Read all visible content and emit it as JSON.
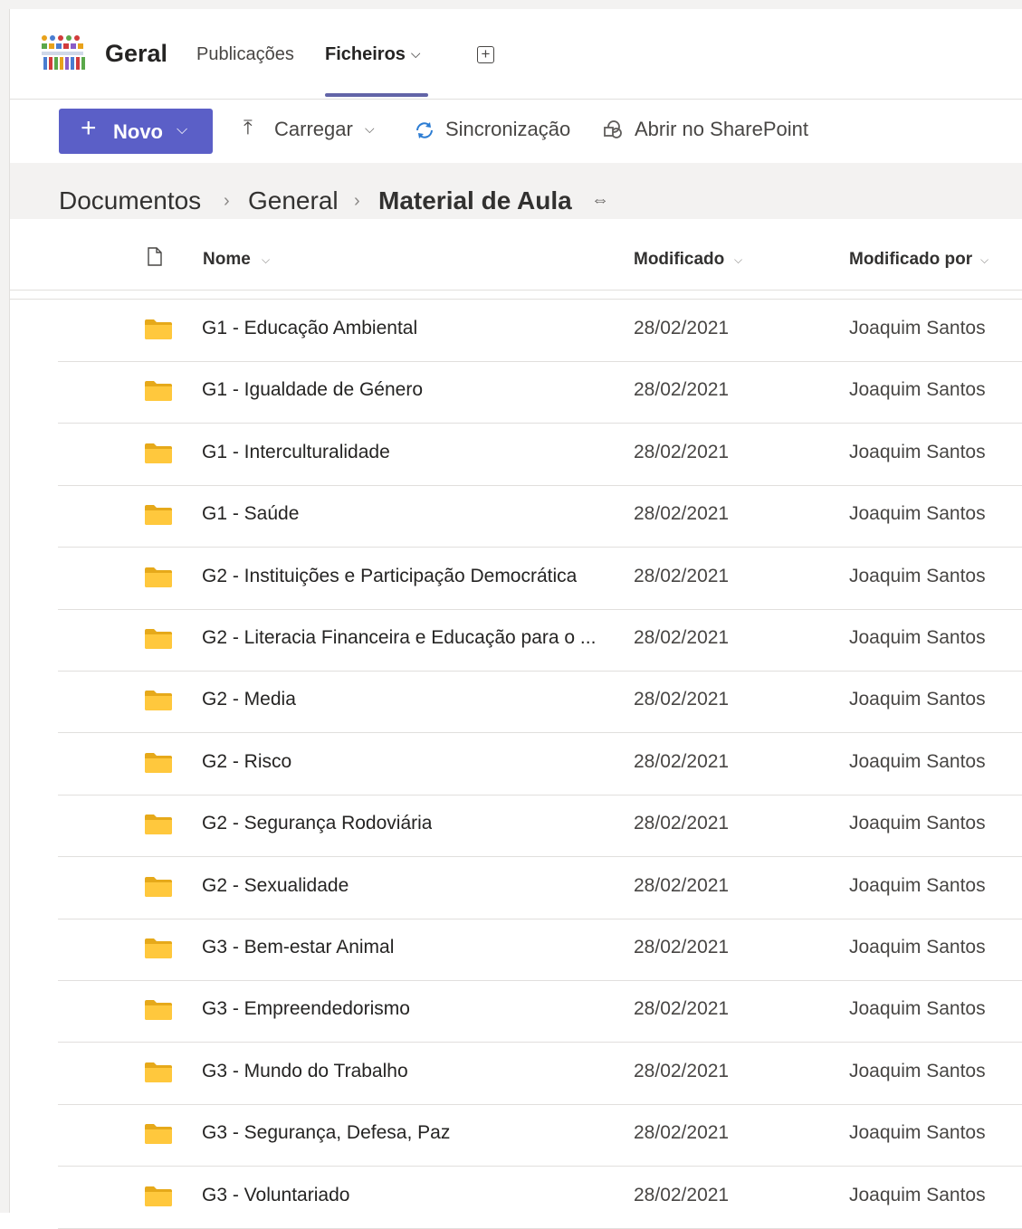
{
  "team": {
    "name": "Geral",
    "logo_icon": "team-logo-icon"
  },
  "tabs": [
    {
      "label": "Publicações"
    },
    {
      "label": "Ficheiros",
      "active": true
    }
  ],
  "accent_color": "#5b5fc7",
  "toolbar": {
    "new_label": "Novo",
    "upload_label": "Carregar",
    "sync_label": "Sincronização",
    "sharepoint_label": "Abrir no SharePoint"
  },
  "breadcrumb": [
    "Documentos",
    "General",
    "Material de Aula"
  ],
  "columns": {
    "name": "Nome",
    "modified": "Modificado",
    "modified_by": "Modificado por"
  },
  "rows": [
    {
      "name": "G1 - Educação Ambiental",
      "modified": "28/02/2021",
      "modified_by": "Joaquim Santos"
    },
    {
      "name": "G1 - Igualdade de Género",
      "modified": "28/02/2021",
      "modified_by": "Joaquim Santos"
    },
    {
      "name": "G1 - Interculturalidade",
      "modified": "28/02/2021",
      "modified_by": "Joaquim Santos"
    },
    {
      "name": "G1 - Saúde",
      "modified": "28/02/2021",
      "modified_by": "Joaquim Santos"
    },
    {
      "name": "G2 - Instituições e Participação Democrática",
      "modified": "28/02/2021",
      "modified_by": "Joaquim Santos"
    },
    {
      "name": "G2 - Literacia Financeira e Educação para o ...",
      "modified": "28/02/2021",
      "modified_by": "Joaquim Santos"
    },
    {
      "name": "G2 - Media",
      "modified": "28/02/2021",
      "modified_by": "Joaquim Santos"
    },
    {
      "name": "G2 - Risco",
      "modified": "28/02/2021",
      "modified_by": "Joaquim Santos"
    },
    {
      "name": "G2 - Segurança Rodoviária",
      "modified": "28/02/2021",
      "modified_by": "Joaquim Santos"
    },
    {
      "name": "G2 - Sexualidade",
      "modified": "28/02/2021",
      "modified_by": "Joaquim Santos"
    },
    {
      "name": "G3 - Bem-estar Animal",
      "modified": "28/02/2021",
      "modified_by": "Joaquim Santos"
    },
    {
      "name": "G3 - Empreendedorismo",
      "modified": "28/02/2021",
      "modified_by": "Joaquim Santos"
    },
    {
      "name": "G3 - Mundo do Trabalho",
      "modified": "28/02/2021",
      "modified_by": "Joaquim Santos"
    },
    {
      "name": "G3 - Segurança, Defesa, Paz",
      "modified": "28/02/2021",
      "modified_by": "Joaquim Santos"
    },
    {
      "name": "G3 - Voluntariado",
      "modified": "28/02/2021",
      "modified_by": "Joaquim Santos"
    }
  ]
}
